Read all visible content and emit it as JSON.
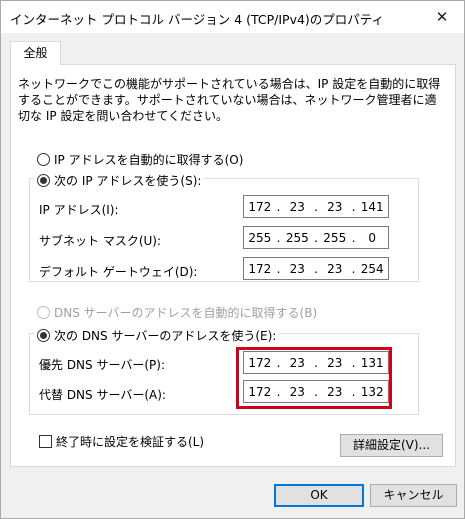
{
  "window": {
    "title": "インターネット プロトコル バージョン 4 (TCP/IPv4)のプロパティ",
    "close_glyph": "✕"
  },
  "tabs": [
    {
      "label": "全般"
    }
  ],
  "description": "ネットワークでこの機能がサポートされている場合は、IP 設定を自動的に取得することができます。サポートされていない場合は、ネットワーク管理者に適切な IP 設定を問い合わせてください。",
  "ip_section": {
    "auto_label": "IP アドレスを自動的に取得する(O)",
    "manual_label": "次の IP アドレスを使う(S):",
    "selected": "manual",
    "fields": [
      {
        "label": "IP アドレス(I):",
        "octets": [
          "172",
          "23",
          "23",
          "141"
        ]
      },
      {
        "label": "サブネット マスク(U):",
        "octets": [
          "255",
          "255",
          "255",
          "0"
        ]
      },
      {
        "label": "デフォルト ゲートウェイ(D):",
        "octets": [
          "172",
          "23",
          "23",
          "254"
        ]
      }
    ]
  },
  "dns_section": {
    "auto_label": "DNS サーバーのアドレスを自動的に取得する(B)",
    "manual_label": "次の DNS サーバーのアドレスを使う(E):",
    "selected": "manual",
    "fields": [
      {
        "label": "優先 DNS サーバー(P):",
        "octets": [
          "172",
          "23",
          "23",
          "131"
        ]
      },
      {
        "label": "代替 DNS サーバー(A):",
        "octets": [
          "172",
          "23",
          "23",
          "132"
        ]
      }
    ]
  },
  "validate_on_exit": {
    "label": "終了時に設定を検証する(L)",
    "checked": false
  },
  "buttons": {
    "advanced": "詳細設定(V)...",
    "ok": "OK",
    "cancel": "キャンセル"
  },
  "colors": {
    "highlight": "#d0021b",
    "focus": "#0078d7"
  }
}
